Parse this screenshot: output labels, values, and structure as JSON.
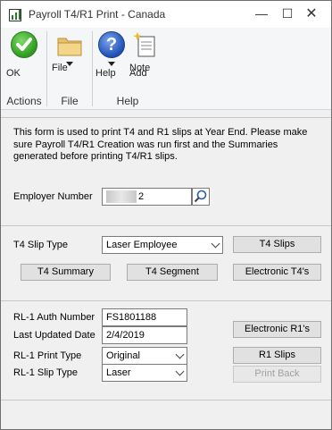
{
  "window": {
    "title": "Payroll T4/R1 Print - Canada"
  },
  "ribbon": {
    "ok_label": "OK",
    "file_label": "File",
    "help_label": "Help",
    "add_note_line1": "Add",
    "add_note_line2": "Note",
    "group_actions": "Actions",
    "group_file": "File",
    "group_help": "Help"
  },
  "info_text": "This form is used to print T4 and R1 slips at Year End. Please make sure Payroll T4/R1 Creation was run first and the Summaries generated before printing T4/R1 slips.",
  "employer": {
    "label": "Employer Number",
    "value": "2"
  },
  "t4": {
    "slip_type_label": "T4 Slip Type",
    "slip_type_value": "Laser Employee",
    "t4_slips_button": "T4 Slips",
    "t4_summary_button": "T4 Summary",
    "t4_segment_button": "T4 Segment",
    "electronic_t4_button": "Electronic T4's"
  },
  "rl1": {
    "auth_label": "RL-1 Auth Number",
    "auth_value": "FS1801188",
    "last_updated_label": "Last Updated Date",
    "last_updated_value": "2/4/2019",
    "print_type_label": "RL-1 Print Type",
    "print_type_value": "Original",
    "slip_type_label": "RL-1 Slip Type",
    "slip_type_value": "Laser",
    "electronic_r1_button": "Electronic R1's",
    "r1_slips_button": "R1 Slips",
    "print_back_button": "Print Back"
  }
}
